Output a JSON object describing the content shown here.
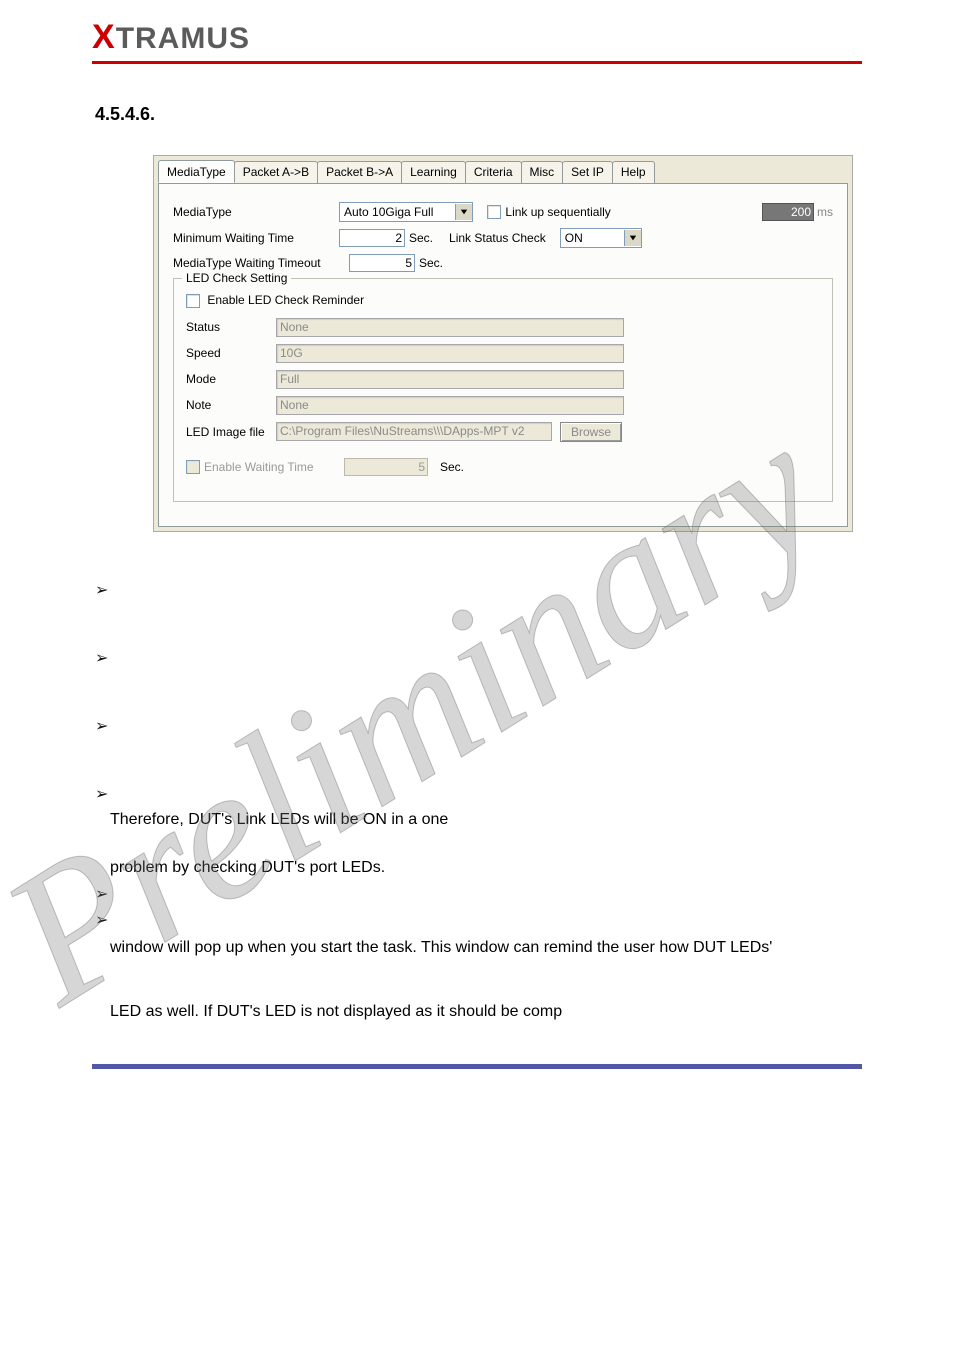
{
  "logo": {
    "x": "X",
    "rest": "TRAMUS"
  },
  "section_number": "4.5.4.6.",
  "tabs": {
    "media_type": "MediaType",
    "packet_ab": "Packet A->B",
    "packet_ba": "Packet B->A",
    "learning": "Learning",
    "criteria": "Criteria",
    "misc": "Misc",
    "set_ip": "Set IP",
    "help": "Help"
  },
  "form": {
    "media_type_label": "MediaType",
    "media_type_value": "Auto 10Giga Full",
    "link_up_seq_label": "Link up sequentially",
    "link_up_ms": "200",
    "ms_unit": "ms",
    "min_wait_label": "Minimum Waiting Time",
    "min_wait_value": "2",
    "sec_unit": "Sec.",
    "link_status_check_label": "Link Status Check",
    "link_status_value": "ON",
    "media_timeout_label": "MediaType Waiting Timeout",
    "media_timeout_value": "5"
  },
  "group": {
    "legend": "LED Check Setting",
    "enable_check_label": "Enable LED Check Reminder",
    "status_label": "Status",
    "status_value": "None",
    "speed_label": "Speed",
    "speed_value": "10G",
    "mode_label": "Mode",
    "mode_value": "Full",
    "note_label": "Note",
    "note_value": "None",
    "image_label": "LED Image file",
    "image_value": "C:\\Program Files\\NuStreams\\\\\\DApps-MPT v2",
    "browse_label": "Browse",
    "enable_waiting_label": "Enable Waiting Time",
    "enable_waiting_value": "5",
    "enable_waiting_unit": "Sec."
  },
  "paragraphs": {
    "p1": "Therefore, DUT's Link LEDs will be ON in a one",
    "p2": "problem by checking DUT's port LEDs.",
    "p3": "window will pop up when you start the task. This window can remind the user how DUT LEDs'",
    "p4": "LED as well. If DUT's LED is not displayed as it should be comp"
  }
}
